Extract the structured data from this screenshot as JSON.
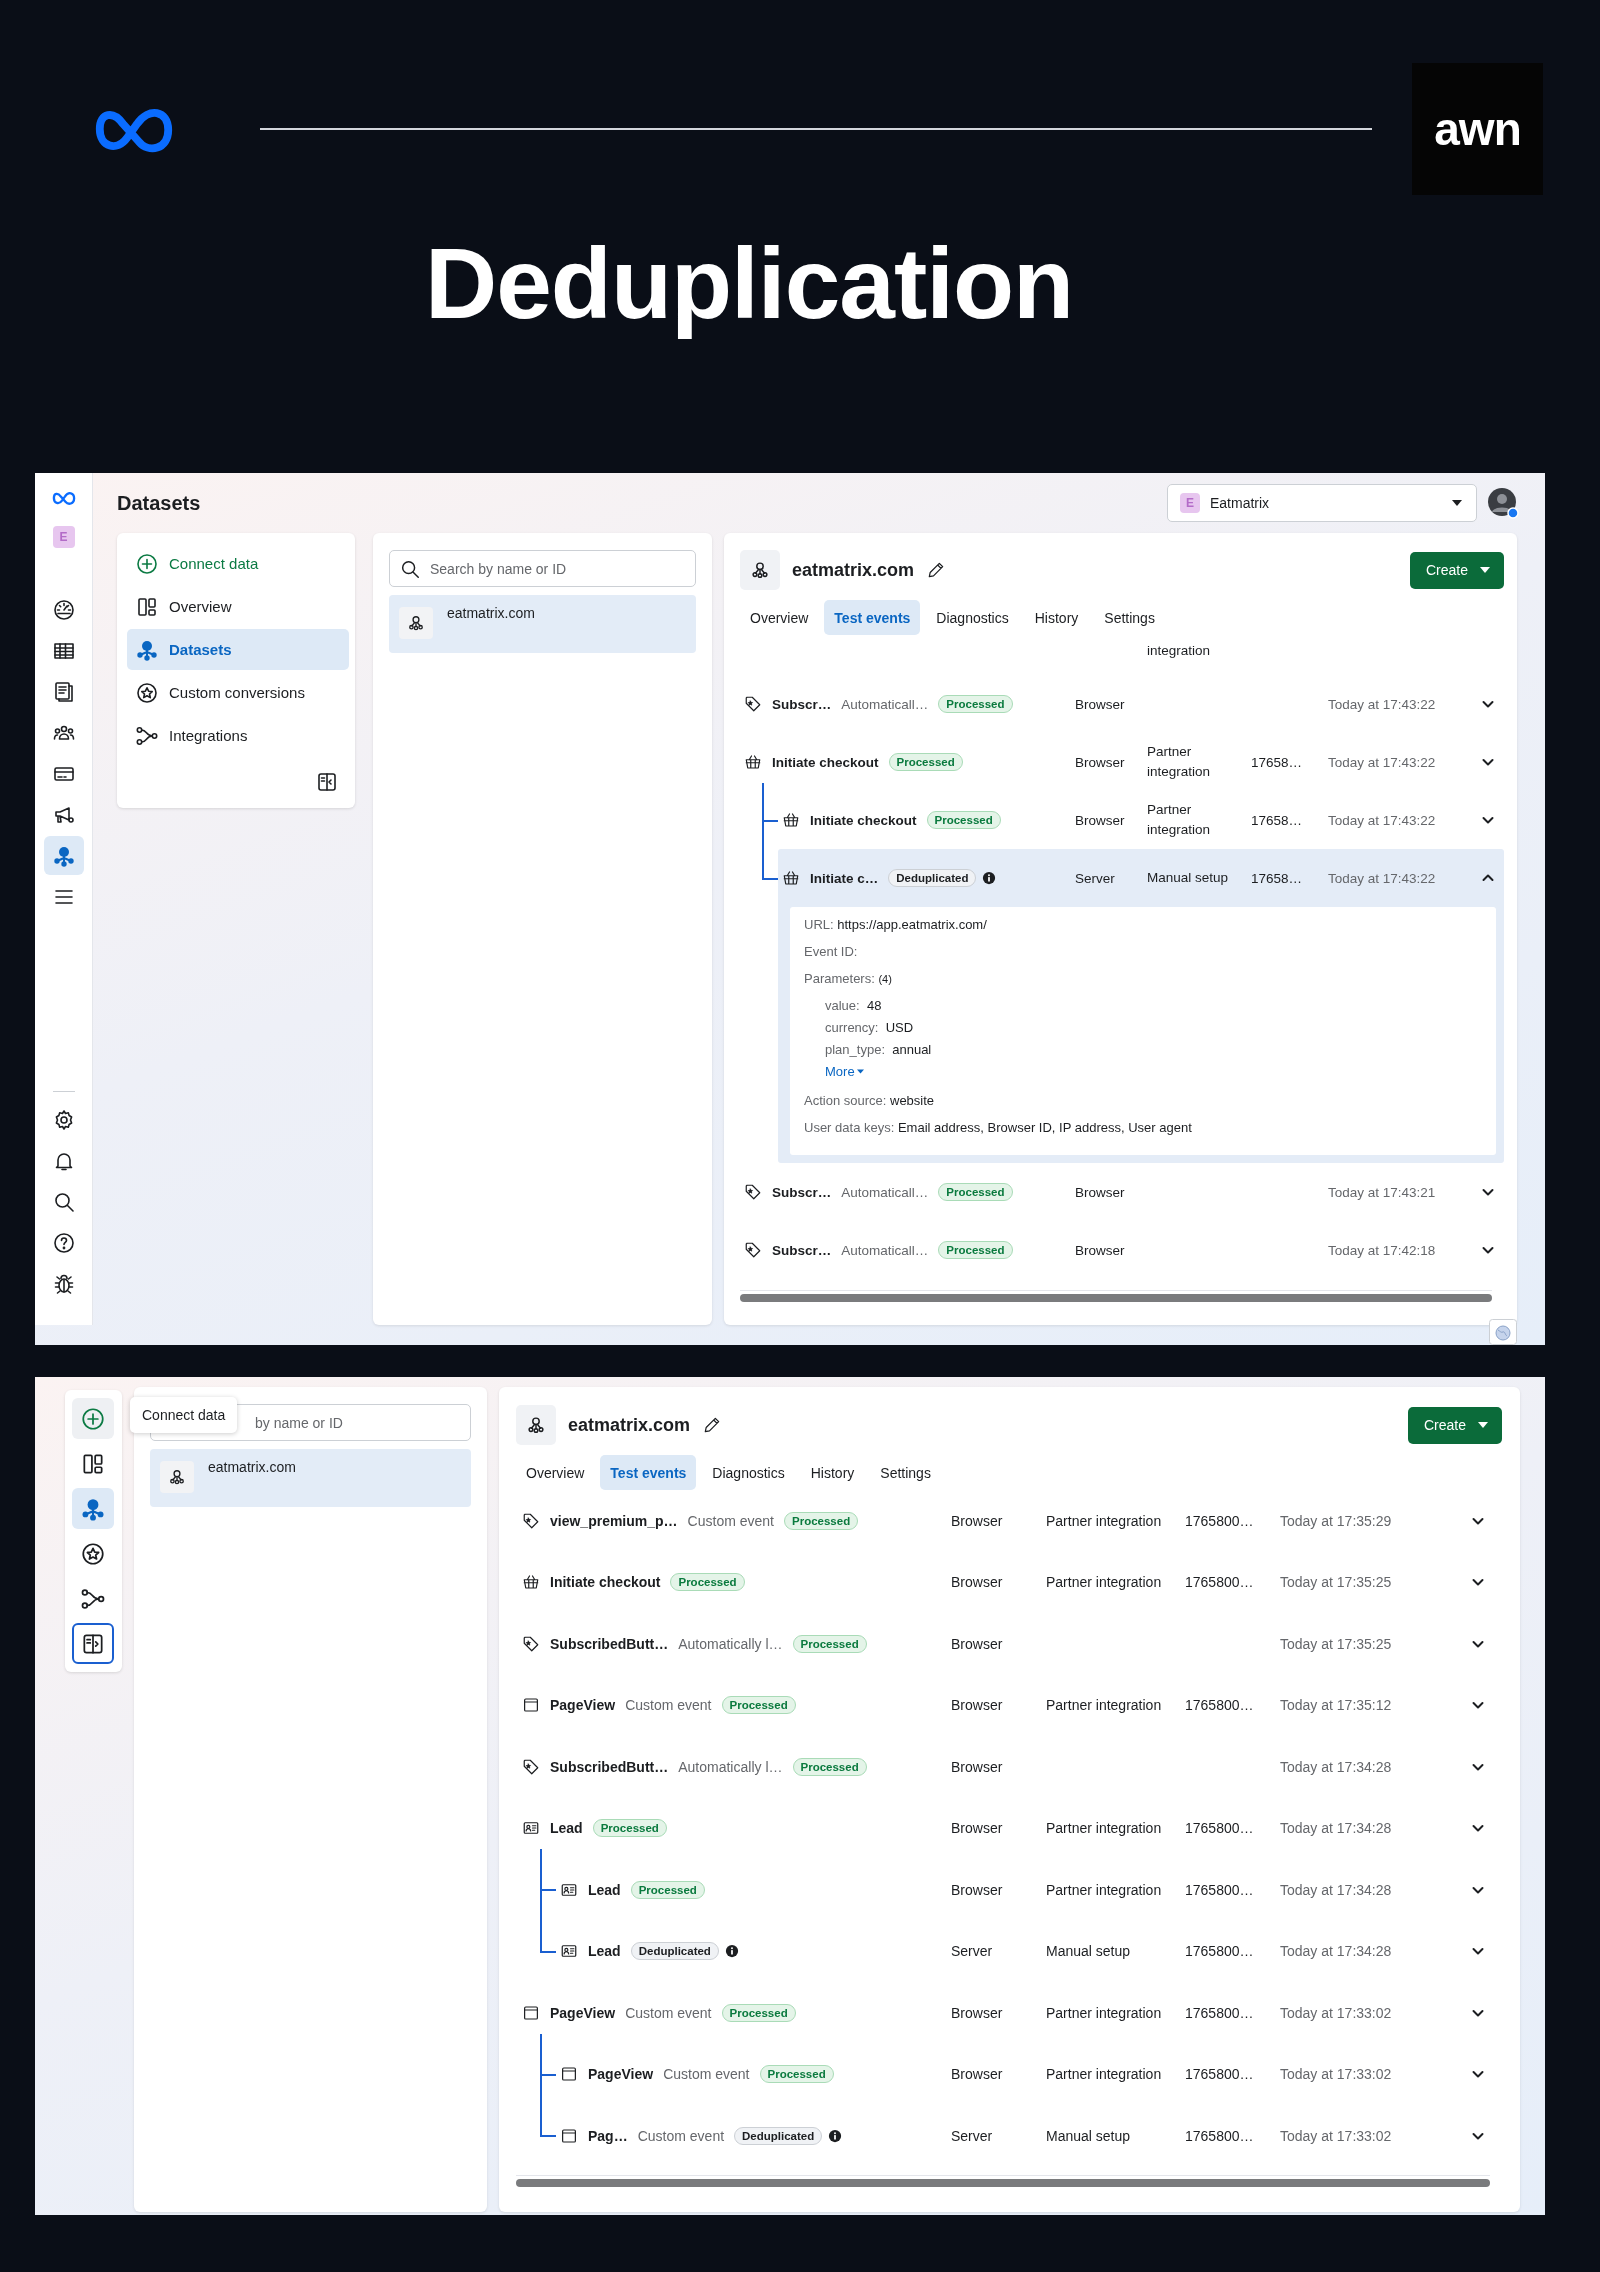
{
  "header": {
    "brand_logo": "awn",
    "title": "Deduplication"
  },
  "screenshots": [
    {
      "kind": "expanded",
      "rail": {
        "account_badge": "E",
        "items": [
          {
            "kind": "gauge",
            "selected": false
          },
          {
            "kind": "table",
            "selected": false
          },
          {
            "kind": "pages",
            "selected": false
          },
          {
            "kind": "people",
            "selected": false
          },
          {
            "kind": "card",
            "selected": false
          },
          {
            "kind": "megaphone",
            "selected": false
          },
          {
            "kind": "datasets",
            "selected": true
          },
          {
            "kind": "menu",
            "selected": false
          }
        ],
        "bottom_items": [
          {
            "kind": "gear",
            "selected": false
          },
          {
            "kind": "bell",
            "selected": false
          },
          {
            "kind": "search",
            "selected": false
          },
          {
            "kind": "help",
            "selected": false
          },
          {
            "kind": "bug",
            "selected": false
          }
        ]
      },
      "page_title": "Datasets",
      "account": {
        "badge": "E",
        "name": "Eatmatrix"
      },
      "nav": [
        {
          "kind": "connect",
          "label": "Connect data",
          "selected": false
        },
        {
          "kind": "overview",
          "label": "Overview",
          "selected": false
        },
        {
          "kind": "datasets",
          "label": "Datasets",
          "selected": true
        },
        {
          "kind": "star",
          "label": "Custom conversions",
          "selected": false
        },
        {
          "kind": "integrations",
          "label": "Integrations",
          "selected": false
        }
      ],
      "search": {
        "placeholder": "Search by name or ID"
      },
      "datasets": [
        {
          "name": "eatmatrix.com",
          "selected": true
        }
      ],
      "detail": {
        "title": "eatmatrix.com",
        "create_button": "Create",
        "tabs": [
          {
            "label": "Overview",
            "selected": false
          },
          {
            "label": "Test events",
            "selected": true
          },
          {
            "label": "Diagnostics",
            "selected": false
          },
          {
            "label": "History",
            "selected": false
          },
          {
            "label": "Settings",
            "selected": false
          }
        ],
        "clipped_text": "integration",
        "events": [
          {
            "kind": "tag",
            "name": "Subscr…",
            "description": "Automaticall…",
            "status": "Processed",
            "deduplicated": false,
            "channel": "Browser",
            "time": "Today at 17:43:22",
            "expanded": false
          },
          {
            "kind": "basket",
            "name": "Initiate checkout",
            "status": "Processed",
            "deduplicated": false,
            "channel": "Browser",
            "setup": "Partner integration",
            "event_id": "17658…",
            "time": "Today at 17:43:22",
            "expanded": false,
            "children": [
              {
                "kind": "basket",
                "name": "Initiate checkout",
                "status": "Processed",
                "deduplicated": false,
                "channel": "Browser",
                "setup": "Partner integration",
                "event_id": "17658…",
                "time": "Today at 17:43:22",
                "expanded": false
              },
              {
                "kind": "basket",
                "name": "Initiate c…",
                "status": "Deduplicated",
                "deduplicated": true,
                "channel": "Server",
                "setup": "Manual setup",
                "event_id": "17658…",
                "time": "Today at 17:43:22",
                "expanded": true,
                "details": {
                  "url_label": "URL:",
                  "url": "https://app.eatmatrix.com/",
                  "event_id_label": "Event ID:",
                  "parameters_label": "Parameters:",
                  "parameters_count": "(4)",
                  "parameters": [
                    {
                      "label": "value:",
                      "value": "48"
                    },
                    {
                      "label": "currency:",
                      "value": "USD"
                    },
                    {
                      "label": "plan_type:",
                      "value": "annual"
                    }
                  ],
                  "more_link": "More",
                  "action_source_label": "Action source:",
                  "action_source": "website",
                  "user_data_label": "User data keys:",
                  "user_data": "Email address, Browser ID, IP address, User agent"
                }
              }
            ]
          },
          {
            "kind": "tag",
            "name": "Subscr…",
            "description": "Automaticall…",
            "status": "Processed",
            "deduplicated": false,
            "channel": "Browser",
            "time": "Today at 17:43:21",
            "expanded": false
          },
          {
            "kind": "tag",
            "name": "Subscr…",
            "description": "Automaticall…",
            "status": "Processed",
            "deduplicated": false,
            "channel": "Browser",
            "time": "Today at 17:42:18",
            "expanded": false
          }
        ]
      }
    },
    {
      "kind": "collapsed",
      "rail": {
        "items": [
          {
            "kind": "connect",
            "selected": false,
            "hovered": true
          },
          {
            "kind": "overview",
            "selected": false,
            "hovered": false
          },
          {
            "kind": "datasets",
            "selected": true,
            "hovered": false
          },
          {
            "kind": "star",
            "selected": false,
            "hovered": false
          },
          {
            "kind": "integrations",
            "selected": false,
            "hovered": false
          }
        ],
        "toggle": {
          "focused": true
        }
      },
      "tooltip": "Connect data",
      "search": {
        "placeholder": "by name or ID"
      },
      "datasets": [
        {
          "name": "eatmatrix.com",
          "selected": true
        }
      ],
      "detail": {
        "title": "eatmatrix.com",
        "create_button": "Create",
        "tabs": [
          {
            "label": "Overview",
            "selected": false
          },
          {
            "label": "Test events",
            "selected": true
          },
          {
            "label": "Diagnostics",
            "selected": false
          },
          {
            "label": "History",
            "selected": false
          },
          {
            "label": "Settings",
            "selected": false
          }
        ],
        "events": [
          {
            "kind": "tag",
            "name": "view_premium_p…",
            "description": "Custom event",
            "status": "Processed",
            "deduplicated": false,
            "channel": "Browser",
            "setup": "Partner integration",
            "event_id": "1765800…",
            "time": "Today at 17:35:29",
            "expanded": false
          },
          {
            "kind": "basket",
            "name": "Initiate checkout",
            "status": "Processed",
            "deduplicated": false,
            "channel": "Browser",
            "setup": "Partner integration",
            "event_id": "1765800…",
            "time": "Today at 17:35:25",
            "expanded": false
          },
          {
            "kind": "tag",
            "name": "SubscribedButt…",
            "description": "Automatically l…",
            "status": "Processed",
            "deduplicated": false,
            "channel": "Browser",
            "time": "Today at 17:35:25",
            "expanded": false
          },
          {
            "kind": "page",
            "name": "PageView",
            "description": "Custom event",
            "status": "Processed",
            "deduplicated": false,
            "channel": "Browser",
            "setup": "Partner integration",
            "event_id": "1765800…",
            "time": "Today at 17:35:12",
            "expanded": false
          },
          {
            "kind": "tag",
            "name": "SubscribedButt…",
            "description": "Automatically l…",
            "status": "Processed",
            "deduplicated": false,
            "channel": "Browser",
            "time": "Today at 17:34:28",
            "expanded": false
          },
          {
            "kind": "lead",
            "name": "Lead",
            "status": "Processed",
            "deduplicated": false,
            "channel": "Browser",
            "setup": "Partner integration",
            "event_id": "1765800…",
            "time": "Today at 17:34:28",
            "expanded": false,
            "children": [
              {
                "kind": "lead",
                "name": "Lead",
                "status": "Processed",
                "deduplicated": false,
                "channel": "Browser",
                "setup": "Partner integration",
                "event_id": "1765800…",
                "time": "Today at 17:34:28",
                "expanded": false
              },
              {
                "kind": "lead",
                "name": "Lead",
                "status": "Deduplicated",
                "deduplicated": true,
                "channel": "Server",
                "setup": "Manual setup",
                "event_id": "1765800…",
                "time": "Today at 17:34:28",
                "expanded": false
              }
            ]
          },
          {
            "kind": "page",
            "name": "PageView",
            "description": "Custom event",
            "status": "Processed",
            "deduplicated": false,
            "channel": "Browser",
            "setup": "Partner integration",
            "event_id": "1765800…",
            "time": "Today at 17:33:02",
            "expanded": false,
            "children": [
              {
                "kind": "page",
                "name": "PageView",
                "description": "Custom event",
                "status": "Processed",
                "deduplicated": false,
                "channel": "Browser",
                "setup": "Partner integration",
                "event_id": "1765800…",
                "time": "Today at 17:33:02",
                "expanded": false
              },
              {
                "kind": "page",
                "name": "Pag…",
                "description": "Custom event",
                "status": "Deduplicated",
                "deduplicated": true,
                "channel": "Server",
                "setup": "Manual setup",
                "event_id": "1765800…",
                "time": "Today at 17:33:02",
                "expanded": false
              }
            ]
          }
        ]
      }
    }
  ]
}
